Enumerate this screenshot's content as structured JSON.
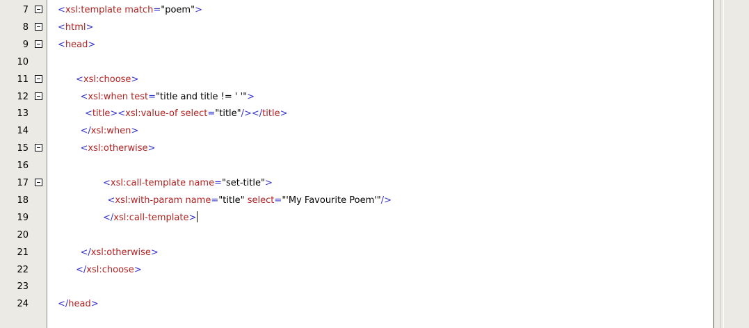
{
  "editor": {
    "lines": [
      {
        "number": "7",
        "fold": true,
        "indent": 0,
        "html": "<span class='b'>&lt;</span><span class='t'>xsl:template</span> <span class='a'>match</span><span class='b'>=</span><span class='v'>\"poem\"</span><span class='b'>&gt;</span>"
      },
      {
        "number": "8",
        "fold": true,
        "indent": 0,
        "html": "<span class='b'>&lt;</span><span class='t'>html</span><span class='b'>&gt;</span>"
      },
      {
        "number": "9",
        "fold": true,
        "indent": 0,
        "html": "<span class='b'>&lt;</span><span class='t'>head</span><span class='b'>&gt;</span>"
      },
      {
        "number": "10",
        "fold": false,
        "indent": 0,
        "html": ""
      },
      {
        "number": "11",
        "fold": true,
        "indent": 4,
        "html": "<span class='b'>&lt;</span><span class='t'>xsl:choose</span><span class='b'>&gt;</span>"
      },
      {
        "number": "12",
        "fold": true,
        "indent": 5,
        "html": "<span class='b'>&lt;</span><span class='t'>xsl:when</span> <span class='a'>test</span><span class='b'>=</span><span class='v'>\"title and title != ' '\"</span><span class='b'>&gt;</span>"
      },
      {
        "number": "13",
        "fold": false,
        "indent": 6,
        "html": "<span class='b'>&lt;</span><span class='t'>title</span><span class='b'>&gt;&lt;</span><span class='t'>xsl:value-of</span> <span class='a'>select</span><span class='b'>=</span><span class='v'>\"title\"</span><span class='b'>/&gt;&lt;/</span><span class='t'>title</span><span class='b'>&gt;</span>"
      },
      {
        "number": "14",
        "fold": false,
        "indent": 5,
        "html": "<span class='b'>&lt;/</span><span class='t'>xsl:when</span><span class='b'>&gt;</span>"
      },
      {
        "number": "15",
        "fold": true,
        "indent": 5,
        "html": "<span class='b'>&lt;</span><span class='t'>xsl:otherwise</span><span class='b'>&gt;</span>"
      },
      {
        "number": "16",
        "fold": false,
        "indent": 0,
        "html": ""
      },
      {
        "number": "17",
        "fold": true,
        "indent": 10,
        "html": "<span class='b'>&lt;</span><span class='t'>xsl:call-template</span> <span class='a'>name</span><span class='b'>=</span><span class='v'>\"set-title\"</span><span class='b'>&gt;</span>"
      },
      {
        "number": "18",
        "fold": false,
        "indent": 11,
        "html": "<span class='b'>&lt;</span><span class='t'>xsl:with-param</span> <span class='a'>name</span><span class='b'>=</span><span class='v'>\"title\"</span> <span class='a'>select</span><span class='b'>=</span><span class='v'>\"'My Favourite Poem'\"</span><span class='b'>/&gt;</span>"
      },
      {
        "number": "19",
        "fold": false,
        "indent": 10,
        "html": "<span class='b'>&lt;/</span><span class='t'>xsl:call-template</span><span class='b'>&gt;</span>",
        "cursor": true
      },
      {
        "number": "20",
        "fold": false,
        "indent": 0,
        "html": ""
      },
      {
        "number": "21",
        "fold": false,
        "indent": 5,
        "html": "<span class='b'>&lt;/</span><span class='t'>xsl:otherwise</span><span class='b'>&gt;</span>"
      },
      {
        "number": "22",
        "fold": false,
        "indent": 4,
        "html": "<span class='b'>&lt;/</span><span class='t'>xsl:choose</span><span class='b'>&gt;</span>"
      },
      {
        "number": "23",
        "fold": false,
        "indent": 0,
        "html": ""
      },
      {
        "number": "24",
        "fold": false,
        "indent": 0,
        "html": "<span class='b'>&lt;/</span><span class='t'>head</span><span class='b'>&gt;</span>"
      }
    ]
  },
  "colors": {
    "bracket": "#3333cc",
    "tag": "#b22222",
    "attribute": "#b22222",
    "value": "#000000",
    "gutter": "#eceae4"
  }
}
